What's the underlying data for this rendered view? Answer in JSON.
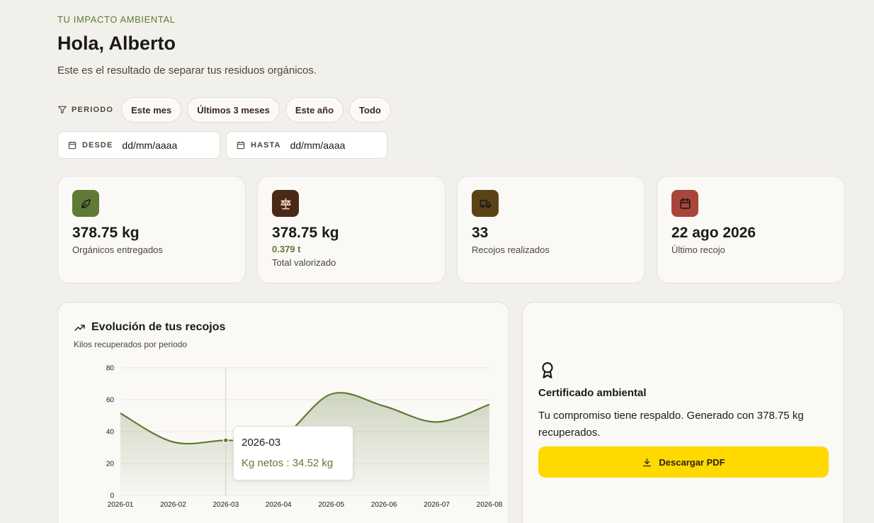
{
  "header": {
    "eyebrow": "TU IMPACTO AMBIENTAL",
    "title": "Hola, Alberto",
    "subtitle": "Este es el resultado de separar tus residuos orgánicos."
  },
  "filters": {
    "period_label": "PERIODO",
    "chips": [
      "Este mes",
      "Últimos 3 meses",
      "Este año",
      "Todo"
    ],
    "from_label": "DESDE",
    "from_placeholder": "dd/mm/aaaa",
    "to_label": "HASTA",
    "to_placeholder": "dd/mm/aaaa"
  },
  "stats": [
    {
      "icon": "leaf-icon",
      "color": "#5f7a35",
      "value": "378.75 kg",
      "sub": "",
      "label": "Orgánicos entregados"
    },
    {
      "icon": "scale-icon",
      "color": "#4a2a17",
      "value": "378.75 kg",
      "sub": "0.379 t",
      "label": "Total valorizado"
    },
    {
      "icon": "truck-icon",
      "color": "#5c4317",
      "value": "33",
      "sub": "",
      "label": "Recojos realizados"
    },
    {
      "icon": "calendar-icon",
      "color": "#a9453a",
      "value": "22 ago 2026",
      "sub": "",
      "label": "Último recojo"
    }
  ],
  "chart": {
    "title": "Evolución de tus recojos",
    "subtitle": "Kilos recuperados por periodo",
    "tooltip": {
      "label": "2026-03",
      "value": "Kg netos : 34.52 kg"
    }
  },
  "chart_data": {
    "type": "area",
    "x": [
      "2026-01",
      "2026-02",
      "2026-03",
      "2026-04",
      "2026-05",
      "2026-06",
      "2026-07",
      "2026-08"
    ],
    "series": [
      {
        "values": [
          51.5,
          33.5,
          34.52,
          35,
          63.5,
          56,
          46,
          57
        ]
      }
    ],
    "yticks": [
      0,
      20,
      40,
      60,
      80
    ],
    "ylim": [
      0,
      80
    ],
    "grid": true,
    "highlight_index": 2,
    "line_color": "#5f7a35"
  },
  "certificate": {
    "title": "Certificado ambiental",
    "text": "Tu compromiso tiene respaldo. Generado con 378.75 kg recuperados.",
    "button_label": "Descargar PDF"
  }
}
